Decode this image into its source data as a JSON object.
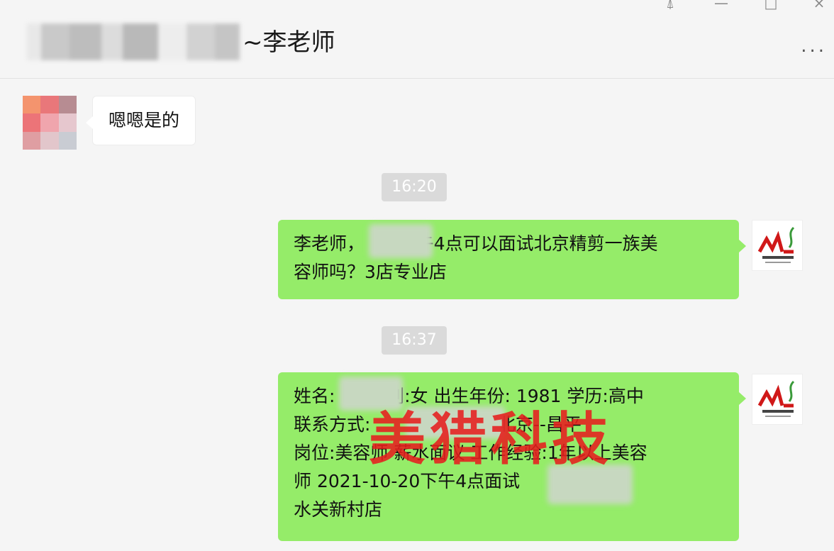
{
  "window": {
    "title_suffix": "~李老师",
    "more_label": "...",
    "pin_icon": "pin-icon",
    "minimize_label": "—",
    "maximize_label": "□",
    "close_label": "×"
  },
  "messages": [
    {
      "type": "received",
      "text": "嗯嗯是的"
    },
    {
      "type": "time",
      "text": "16:20"
    },
    {
      "type": "sent",
      "lines": [
        "李老师，      下午4点可以面试北京精剪一族美",
        "容师吗？3店专业店"
      ]
    },
    {
      "type": "time",
      "text": "16:37"
    },
    {
      "type": "sent",
      "lines": [
        "姓名:      性别:女 出生年份: 1981 学历:高中",
        "联系方式:          工作地点北京--昌平",
        "岗位:美容师 薪水面议 工作经验:1年以上美容",
        "师 2021-10-20下午4点面试         美容师",
        "水关新村店"
      ]
    }
  ],
  "watermark": "美猎科技",
  "colors": {
    "sent_bubble": "#95ec69",
    "received_bubble": "#ffffff",
    "background": "#f5f5f5",
    "timestamp_bg": "#dadada",
    "watermark": "#e61e1e"
  }
}
